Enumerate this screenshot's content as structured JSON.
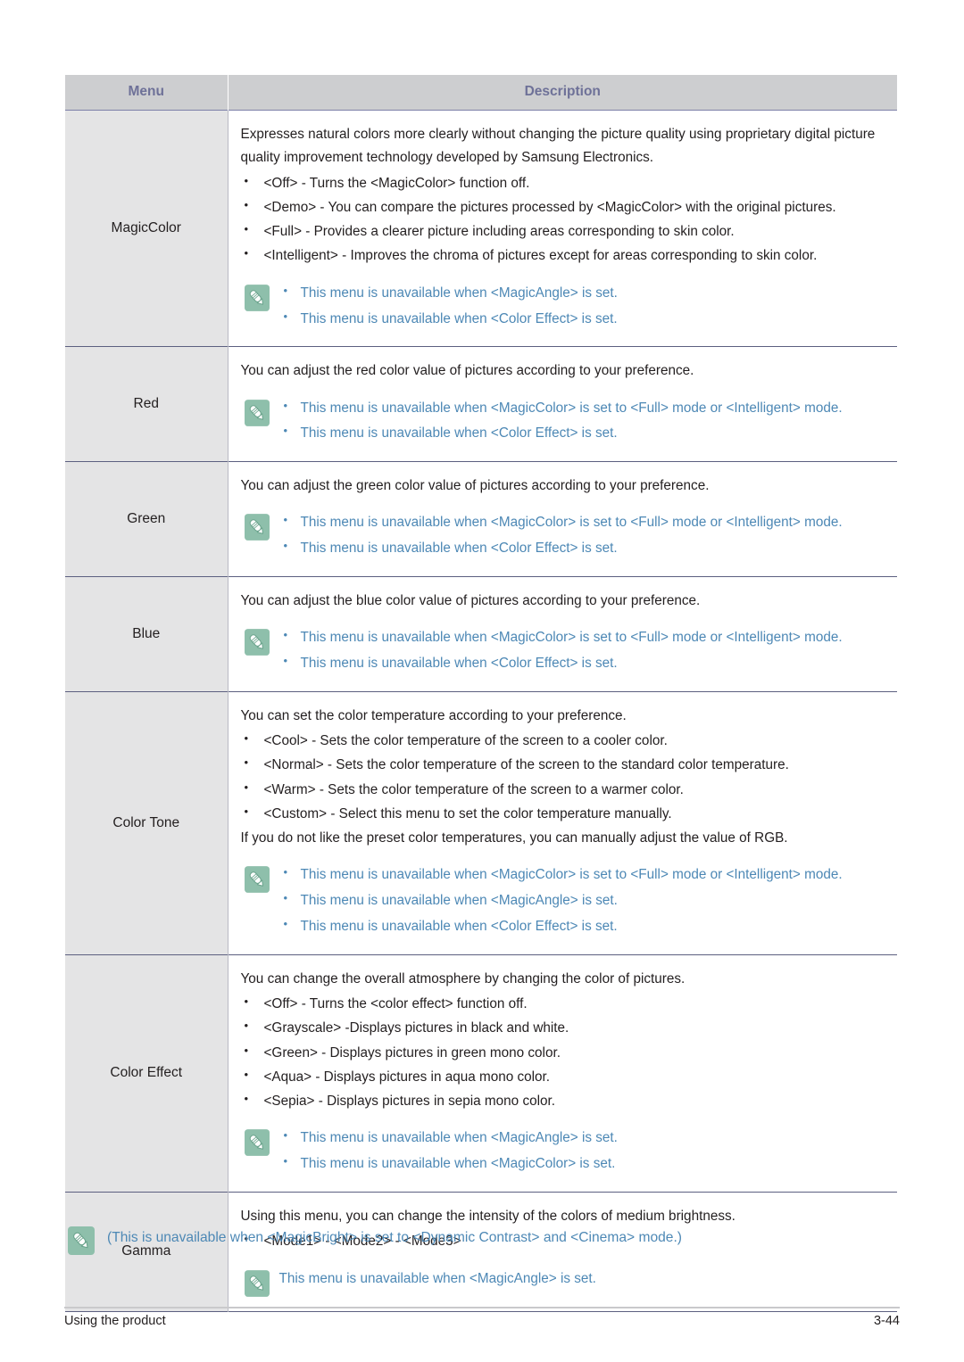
{
  "document": {
    "table": {
      "headers": {
        "menu": "Menu",
        "description": "Description"
      },
      "rows": [
        {
          "menu": "MagicColor",
          "paragraphs": [
            "Expresses natural colors more clearly without changing the picture quality using proprietary digital picture quality improvement technology developed by Samsung Electronics."
          ],
          "bullets": [
            "<Off> - Turns the <MagicColor> function off.",
            "<Demo> - You can compare the pictures processed by <MagicColor> with the original pictures.",
            "<Full> - Provides a clearer picture including areas corresponding to skin color.",
            "<Intelligent> - Improves the chroma of pictures except for areas corresponding to skin color."
          ],
          "notes": [
            "This menu is unavailable when <MagicAngle> is set.",
            "This menu is unavailable when <Color Effect> is set."
          ],
          "notes_bulleted": true
        },
        {
          "menu": "Red",
          "paragraphs": [
            "You can adjust the red color value of pictures according to your preference."
          ],
          "bullets": [],
          "notes": [
            "This menu is unavailable when <MagicColor> is set to <Full> mode or <Intelligent> mode.",
            "This menu is unavailable when <Color Effect> is set."
          ],
          "notes_bulleted": true
        },
        {
          "menu": "Green",
          "paragraphs": [
            "You can adjust the green color value of pictures according to your preference."
          ],
          "bullets": [],
          "notes": [
            "This menu is unavailable when <MagicColor> is set to <Full> mode or <Intelligent> mode.",
            "This menu is unavailable when <Color Effect> is set."
          ],
          "notes_bulleted": true
        },
        {
          "menu": "Blue",
          "paragraphs": [
            "You can adjust the blue color value of pictures according to your preference."
          ],
          "bullets": [],
          "notes": [
            "This menu is unavailable when <MagicColor> is set to <Full> mode or <Intelligent> mode.",
            "This menu is unavailable when <Color Effect> is set."
          ],
          "notes_bulleted": true
        },
        {
          "menu": "Color Tone",
          "paragraphs": [
            "You can set the color temperature according to your preference."
          ],
          "bullets": [
            "<Cool> - Sets the color temperature of the screen to a cooler color.",
            "<Normal> - Sets the color temperature of the screen to the standard color temperature.",
            "<Warm> - Sets the color temperature of the screen to a warmer color.",
            "<Custom> - Select this menu to set the color temperature manually."
          ],
          "paragraphs_after": [
            "If you do not like the preset color temperatures, you can manually adjust the value of RGB."
          ],
          "notes": [
            "This menu is unavailable when <MagicColor> is set to <Full> mode or <Intelligent> mode.",
            "This menu is unavailable when <MagicAngle> is set.",
            "This menu is unavailable when <Color Effect> is set."
          ],
          "notes_bulleted": true
        },
        {
          "menu": "Color Effect",
          "paragraphs": [
            "You can change the overall atmosphere by changing the color of pictures."
          ],
          "bullets": [
            "<Off> - Turns the <color effect> function off.",
            "<Grayscale> -Displays pictures in black and white.",
            "<Green> - Displays pictures in green mono color.",
            "<Aqua> - Displays pictures in aqua mono color.",
            "<Sepia> - Displays pictures in sepia mono color."
          ],
          "notes": [
            "This menu is unavailable when <MagicAngle> is set.",
            "This menu is unavailable when <MagicColor> is set."
          ],
          "notes_bulleted": true
        },
        {
          "menu": "Gamma",
          "paragraphs": [
            "Using this menu, you can change the intensity of the colors of medium brightness."
          ],
          "bullets": [
            "<Mode1> - <Mode2> - <Mode3>"
          ],
          "notes": [
            "This menu is unavailable when <MagicAngle> is set."
          ],
          "notes_bulleted": false
        }
      ]
    },
    "bottom_note": {
      "icon": "note-pencil-icon",
      "text": "(This is unavailable when <MagicBright> is set to <Dynamic Contrast> and <Cinema> mode.)"
    },
    "footer": {
      "left": "Using the product",
      "right": "3-44"
    },
    "colors": {
      "header_bg": "#cdced0",
      "header_text": "#6e7198",
      "menu_cell_bg": "#e4e4e5",
      "note_text": "#4d88b5",
      "note_icon_bg": "#8ebfab",
      "row_border": "#5c5f80",
      "body_text": "#231f20"
    }
  }
}
